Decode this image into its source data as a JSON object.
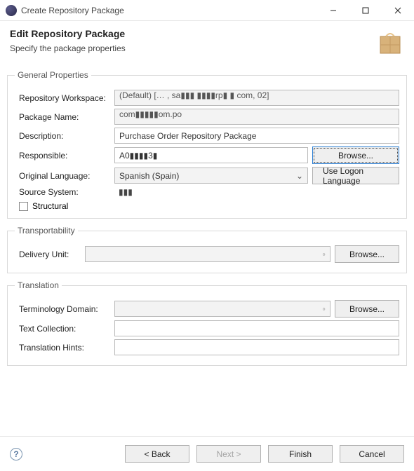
{
  "window": {
    "title": "Create Repository Package"
  },
  "header": {
    "title": "Edit Repository Package",
    "subtitle": "Specify the package properties"
  },
  "sections": {
    "general": {
      "legend": "General Properties",
      "repo_workspace": {
        "label": "Repository Workspace:",
        "value": "(Default) [… , sa▮▮▮ ▮▮▮▮rp▮ ▮ com, 02]"
      },
      "package_name": {
        "label": "Package Name:",
        "value": "com▮▮▮▮▮om.po"
      },
      "description": {
        "label": "Description:",
        "value": "Purchase Order Repository Package"
      },
      "responsible": {
        "label": "Responsible:",
        "value": "A0▮▮▮▮3▮",
        "browse": "Browse..."
      },
      "orig_lang": {
        "label": "Original Language:",
        "value": "Spanish (Spain)",
        "use_logon": "Use Logon Language"
      },
      "source_system": {
        "label": "Source System:",
        "value": "▮▮▮"
      },
      "structural": {
        "label": "Structural",
        "checked": false
      }
    },
    "transport": {
      "legend": "Transportability",
      "delivery_unit": {
        "label": "Delivery Unit:",
        "value": "",
        "browse": "Browse..."
      }
    },
    "translation": {
      "legend": "Translation",
      "term_domain": {
        "label": "Terminology Domain:",
        "value": "",
        "browse": "Browse..."
      },
      "text_coll": {
        "label": "Text Collection:",
        "value": ""
      },
      "trans_hints": {
        "label": "Translation Hints:",
        "value": ""
      }
    }
  },
  "footer": {
    "help": "?",
    "back": "< Back",
    "next": "Next >",
    "finish": "Finish",
    "cancel": "Cancel"
  }
}
